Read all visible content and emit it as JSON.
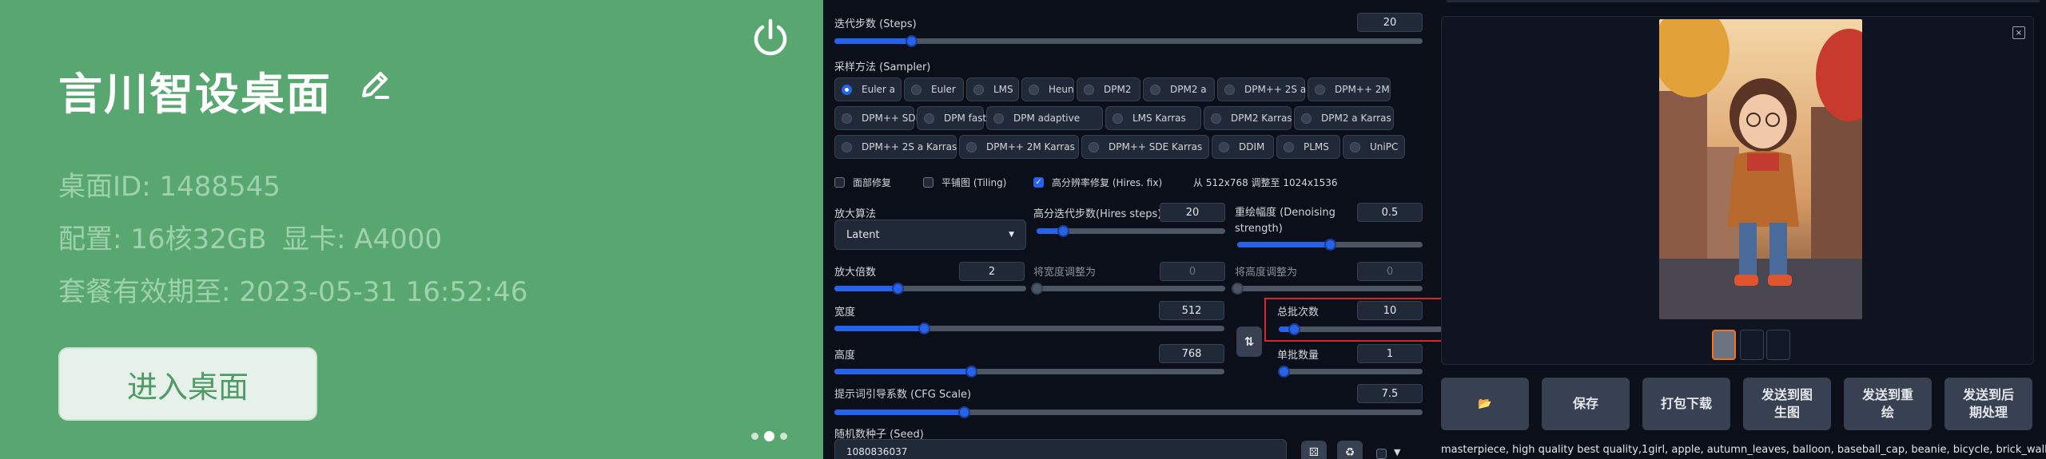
{
  "card": {
    "title": "言川智设桌面",
    "desktop_id": "桌面ID: 1488545",
    "config": "配置: 16核32GB",
    "gpu": "显卡: A4000",
    "expiry": "套餐有效期至: 2023-05-31 16:52:46",
    "enter_label": "进入桌面",
    "icons": [
      "edit-icon",
      "power-icon"
    ]
  },
  "sampling": {
    "steps_label": "迭代步数 (Steps)",
    "steps_value": "20",
    "steps_fraction": 0.13,
    "sampler_label": "采样方法 (Sampler)",
    "samplers": [
      "Euler a",
      "Euler",
      "LMS",
      "Heun",
      "DPM2",
      "DPM2 a",
      "DPM++ 2S a",
      "DPM++ 2M",
      "DPM++ SDE",
      "DPM fast",
      "DPM adaptive",
      "LMS Karras",
      "DPM2 Karras",
      "DPM2 a Karras",
      "DPM++ 2S a Karras",
      "DPM++ 2M Karras",
      "DPM++ SDE Karras",
      "DDIM",
      "PLMS",
      "UniPC"
    ],
    "selected_sampler": "Euler a"
  },
  "checks": {
    "face_restore": "面部修复",
    "tiling": "平铺图 (Tiling)",
    "hires_fix": "高分辨率修复 (Hires. fix)",
    "hires_note": "从 512x768 调整至 1024x1536"
  },
  "hires": {
    "upscaler_label": "放大算法",
    "upscaler_value": "Latent",
    "hires_steps_label": "高分迭代步数(Hires steps)",
    "hires_steps_value": "20",
    "hires_steps_fraction": 0.14,
    "denoise_label": "重绘幅度 (Denoising strength)",
    "denoise_value": "0.5",
    "denoise_fraction": 0.5,
    "scale_label": "放大倍数",
    "scale_value": "2",
    "scale_fraction": 0.33,
    "resize_w_label": "将宽度调整为",
    "resize_w_value": "0",
    "resize_h_label": "将高度调整为",
    "resize_h_value": "0"
  },
  "size": {
    "width_label": "宽度",
    "width_value": "512",
    "width_fraction": 0.23,
    "height_label": "高度",
    "height_value": "768",
    "height_fraction": 0.35,
    "batch_count_label": "总批次数",
    "batch_count_value": "10",
    "batch_count_fraction": 0.09,
    "batch_size_label": "单批数量",
    "batch_size_value": "1",
    "batch_size_fraction": 0.0,
    "swap_label": "⇅"
  },
  "cfg": {
    "label": "提示词引导系数 (CFG Scale)",
    "value": "7.5",
    "fraction": 0.22
  },
  "seed": {
    "label": "随机数种子 (Seed)",
    "value": "1080836037"
  },
  "actions": [
    {
      "label": "📂"
    },
    {
      "label": "保存"
    },
    {
      "label": "打包下载"
    },
    {
      "label": "发送到图\n生图"
    },
    {
      "label": "发送到重\n绘"
    },
    {
      "label": "发送到后\n期处理"
    }
  ],
  "prompt_text": "masterpiece, high quality best quality,1girl, apple, autumn_leaves, balloon, baseball_cap, beanie, bicycle, brick_wall, bridge,",
  "gallery": {
    "close_label": "×"
  },
  "colors": {
    "card_green": "#58a770",
    "accent_blue": "#2563eb",
    "highlight_red": "#dc2626"
  }
}
